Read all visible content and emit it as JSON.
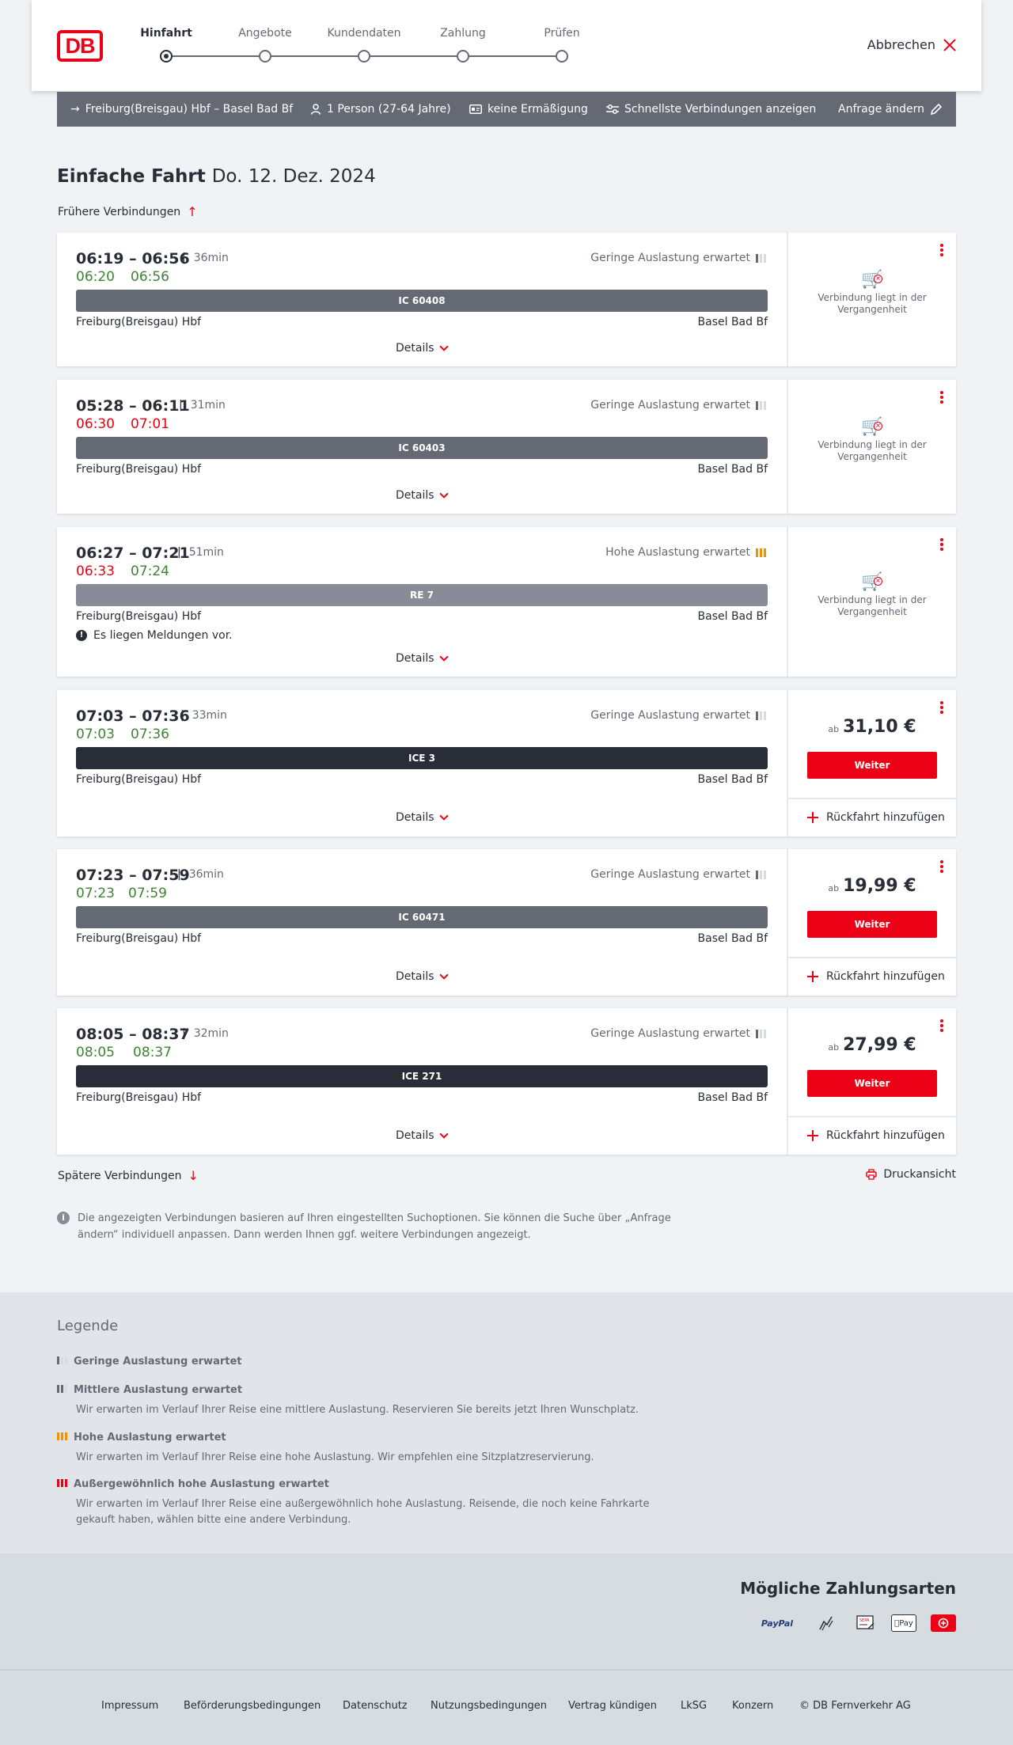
{
  "header": {
    "logo": "DB",
    "steps": [
      {
        "label": "Hinfahrt"
      },
      {
        "label": "Angebote"
      },
      {
        "label": "Kundendaten"
      },
      {
        "label": "Zahlung"
      },
      {
        "label": "Prüfen"
      }
    ],
    "cancel_label": "Abbrechen"
  },
  "searchbar": {
    "route": "Freiburg(Breisgau) Hbf – Basel Bad Bf",
    "passengers": "1 Person (27-64 Jahre)",
    "discount": "keine Ermäßigung",
    "option": "Schnellste Verbindungen anzeigen",
    "edit": "Anfrage ändern"
  },
  "title": {
    "type": "Einfache Fahrt",
    "date": "Do. 12. Dez. 2024"
  },
  "earlier": "Frühere Verbindungen",
  "later": "Spätere Verbindungen",
  "print": "Druckansicht",
  "details_label": "Details",
  "past_label": "Verbindung liegt in der Vergangenheit",
  "price_prefix": "ab",
  "weiter_label": "Weiter",
  "return_label": "Rückfahrt hinzufügen",
  "notice_text": "Es liegen Meldungen vor.",
  "connections": [
    {
      "times": "06:19 – 06:56",
      "duration": "36min",
      "rt_dep": "06:20",
      "rt_arr": "06:56",
      "load": "Geringe Auslastung erwartet",
      "train": "IC 60408",
      "from": "Freiburg(Breisgau) Hbf",
      "to": "Basel Bad Bf"
    },
    {
      "times": "05:28 – 06:11",
      "duration": "31min",
      "rt_dep": "06:30",
      "rt_arr": "07:01",
      "load": "Geringe Auslastung erwartet",
      "train": "IC 60403",
      "from": "Freiburg(Breisgau) Hbf",
      "to": "Basel Bad Bf"
    },
    {
      "times": "06:27 – 07:21",
      "duration": "51min",
      "rt_dep": "06:33",
      "rt_arr": "07:24",
      "load": "Hohe Auslastung erwartet",
      "train": "RE 7",
      "from": "Freiburg(Breisgau) Hbf",
      "to": "Basel Bad Bf"
    },
    {
      "times": "07:03 – 07:36",
      "duration": "33min",
      "rt_dep": "07:03",
      "rt_arr": "07:36",
      "load": "Geringe Auslastung erwartet",
      "train": "ICE 3",
      "from": "Freiburg(Breisgau) Hbf",
      "to": "Basel Bad Bf",
      "price": "31,10 €"
    },
    {
      "times": "07:23 – 07:59",
      "duration": "36min",
      "rt_dep": "07:23",
      "rt_arr": "07:59",
      "load": "Geringe Auslastung erwartet",
      "train": "IC 60471",
      "from": "Freiburg(Breisgau) Hbf",
      "to": "Basel Bad Bf",
      "price": "19,99 €"
    },
    {
      "times": "08:05 – 08:37",
      "duration": "32min",
      "rt_dep": "08:05",
      "rt_arr": "08:37",
      "load": "Geringe Auslastung erwartet",
      "train": "ICE 271",
      "from": "Freiburg(Breisgau) Hbf",
      "to": "Basel Bad Bf",
      "price": "27,99 €"
    }
  ],
  "info_text": "Die angezeigten Verbindungen basieren auf Ihren eingestellten Suchoptionen. Sie können die Suche über „Anfrage ändern“ individuell anpassen. Dann werden Ihnen ggf. weitere Verbindungen angezeigt.",
  "legend": {
    "title": "Legende",
    "items": [
      {
        "title": "Geringe Auslastung erwartet",
        "text": ""
      },
      {
        "title": "Mittlere Auslastung erwartet",
        "text": "Wir erwarten im Verlauf Ihrer Reise eine mittlere Auslastung. Reservieren Sie bereits jetzt Ihren Wunschplatz."
      },
      {
        "title": "Hohe Auslastung erwartet",
        "text": "Wir erwarten im Verlauf Ihrer Reise eine hohe Auslastung. Wir empfehlen eine Sitzplatzreservierung."
      },
      {
        "title": "Außergewöhnlich hohe Auslastung erwartet",
        "text": "Wir erwarten im Verlauf Ihrer Reise eine außergewöhnlich hohe Auslastung. Reisende, die noch keine Fahrkarte gekauft haben, wählen bitte eine andere Verbindung."
      }
    ]
  },
  "payment": {
    "title": "Mögliche Zahlungsarten",
    "paypal": "PayPal",
    "sepa": "SEPA",
    "applepay": "Pay",
    "methods": [
      "paypal-icon",
      "creditcard-icon",
      "sepa-icon",
      "applepay-icon",
      "db-icon"
    ]
  },
  "footer": {
    "links": [
      "Impressum",
      "Beförderungsbedingungen",
      "Datenschutz",
      "Nutzungsbedingungen",
      "Vertrag kündigen",
      "LkSG",
      "Konzern",
      "© DB Fernverkehr AG"
    ]
  },
  "colors": {
    "brand": "#ec0016",
    "ontime": "#408335",
    "dark": "#282d37",
    "gray": "#646973",
    "high_load": "#f39200"
  }
}
